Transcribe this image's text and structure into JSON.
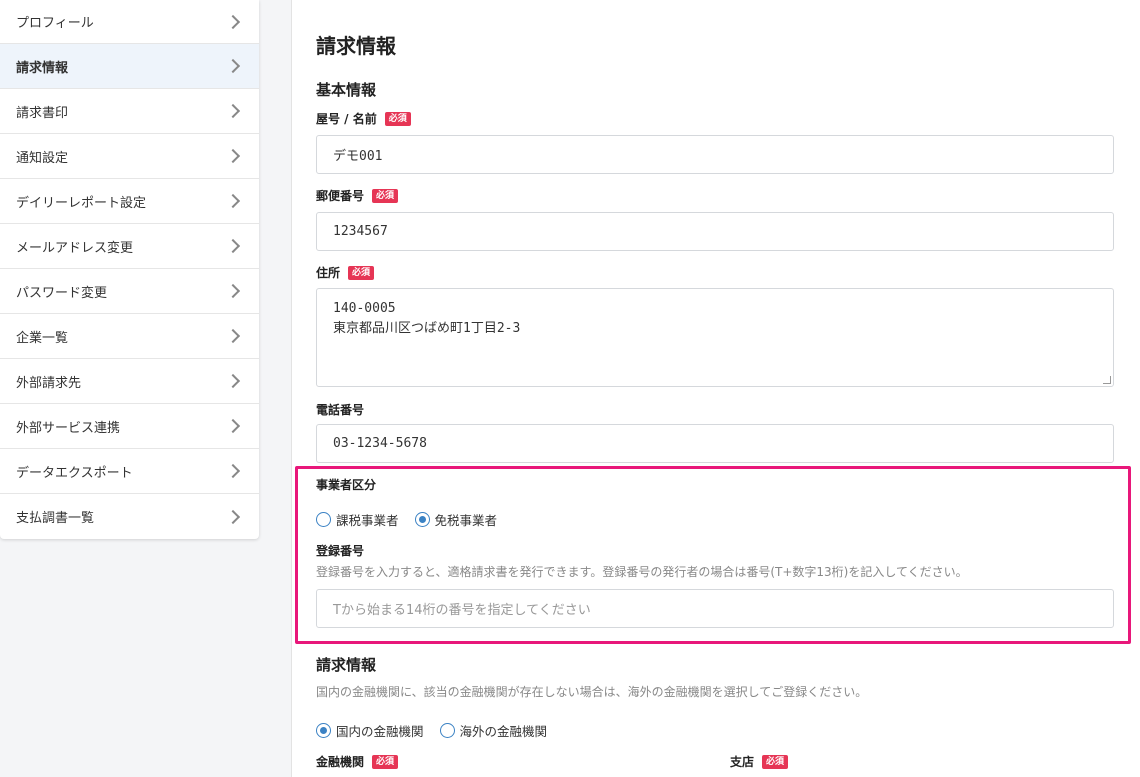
{
  "sidebar": {
    "items": [
      {
        "label": "プロフィール"
      },
      {
        "label": "請求情報"
      },
      {
        "label": "請求書印"
      },
      {
        "label": "通知設定"
      },
      {
        "label": "デイリーレポート設定"
      },
      {
        "label": "メールアドレス変更"
      },
      {
        "label": "パスワード変更"
      },
      {
        "label": "企業一覧"
      },
      {
        "label": "外部請求先"
      },
      {
        "label": "外部サービス連携"
      },
      {
        "label": "データエクスポート"
      },
      {
        "label": "支払調書一覧"
      }
    ],
    "active_index": 1
  },
  "main": {
    "title": "請求情報",
    "basic": {
      "heading": "基本情報",
      "required_badge": "必須",
      "name_label": "屋号 / 名前",
      "name_value": "デモ001",
      "zip_label": "郵便番号",
      "zip_value": "1234567",
      "address_label": "住所",
      "address_line1": "140-0005",
      "address_line2": "東京都品川区つばめ町1丁目2-3",
      "phone_label": "電話番号",
      "phone_value": "03-1234-5678"
    },
    "business": {
      "label": "事業者区分",
      "option_taxable": "課税事業者",
      "option_exempt": "免税事業者",
      "selected": "免税事業者",
      "reg_label": "登録番号",
      "reg_help": "登録番号を入力すると、適格請求書を発行できます。登録番号の発行者の場合は番号(T+数字13桁)を記入してください。",
      "reg_placeholder": "Tから始まる14桁の番号を指定してください"
    },
    "billing": {
      "heading": "請求情報",
      "help": "国内の金融機関に、該当の金融機関が存在しない場合は、海外の金融機関を選択してご登録ください。",
      "option_domestic": "国内の金融機関",
      "option_foreign": "海外の金融機関",
      "selected": "国内の金融機関",
      "bank_label": "金融機関",
      "branch_label": "支店"
    }
  },
  "colors": {
    "accent": "#3b82c4",
    "required": "#e63555",
    "highlight": "#e8177a"
  }
}
